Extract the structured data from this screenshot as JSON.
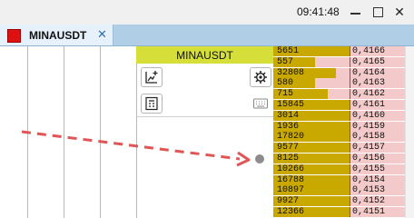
{
  "window": {
    "clock": "09:41:48",
    "close_glyph": "✕"
  },
  "tabs": [
    {
      "label": "MINAUSDT",
      "color": "#dd1111",
      "close_glyph": "✕"
    }
  ],
  "panel": {
    "title": "MINAUSDT",
    "tools": [
      "add-chart-icon",
      "settings-gear-icon",
      "calculator-icon",
      "keyboard-icon"
    ]
  },
  "order_book": {
    "rows": [
      {
        "qty": "5651",
        "price": "0,4166",
        "bar": 0.0
      },
      {
        "qty": "557",
        "price": "0,4165",
        "bar": 0.45
      },
      {
        "qty": "32808",
        "price": "0,4164",
        "bar": 0.18
      },
      {
        "qty": "580",
        "price": "0,4163",
        "bar": 0.45
      },
      {
        "qty": "715",
        "price": "0,4162",
        "bar": 0.28
      },
      {
        "qty": "15845",
        "price": "0,4161",
        "bar": 0.0
      },
      {
        "qty": "3014",
        "price": "0,4160",
        "bar": 0.0
      },
      {
        "qty": "1936",
        "price": "0,4159",
        "bar": 0.0
      },
      {
        "qty": "17820",
        "price": "0,4158",
        "bar": 0.0
      },
      {
        "qty": "9577",
        "price": "0,4157",
        "bar": 0.0
      },
      {
        "qty": "8125",
        "price": "0,4156",
        "bar": 0.0
      },
      {
        "qty": "10266",
        "price": "0,4155",
        "bar": 0.0
      },
      {
        "qty": "16788",
        "price": "0,4154",
        "bar": 0.0
      },
      {
        "qty": "10897",
        "price": "0,4153",
        "bar": 0.0
      },
      {
        "qty": "9927",
        "price": "0,4152",
        "bar": 0.0
      },
      {
        "qty": "12366",
        "price": "0,4151",
        "bar": 0.0
      }
    ]
  },
  "colors": {
    "header": "#d6df3a",
    "bid_cell": "#c9a800",
    "ask_cell": "#f3c9c9",
    "arrow": "#e05555",
    "tab_strip": "#b0cfe6"
  }
}
